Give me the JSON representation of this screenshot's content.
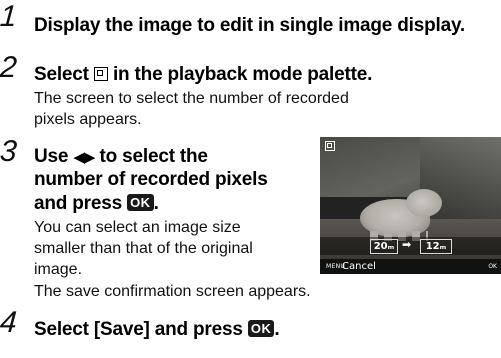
{
  "steps": [
    {
      "number": "1",
      "heading": "Display the image to edit in single image display."
    },
    {
      "number": "2",
      "heading_pre": "Select",
      "heading_icon": "resize-palette-icon",
      "heading_post": "in the playback mode palette.",
      "desc": "The screen to select the number of recorded pixels appears."
    },
    {
      "number": "3",
      "heading_line1_pre": "Use",
      "heading_arrows": "◀▶",
      "heading_line1_post": "to select the",
      "heading_line2": "number of recorded pixels",
      "heading_line3": "and press",
      "ok_label": "OK",
      "desc_lines": [
        "You can select an image size",
        "smaller than that of the original",
        "image."
      ],
      "desc2": "The save confirmation screen appears."
    },
    {
      "number": "4",
      "heading_pre": "Select [Save] and press",
      "ok_label": "OK"
    }
  ],
  "camera_screen": {
    "size_from": "20ₘ",
    "arrow": "➡",
    "size_to": "12ₘ",
    "menu_tag": "MENU",
    "cancel": "Cancel",
    "ok_tag": "OK"
  }
}
